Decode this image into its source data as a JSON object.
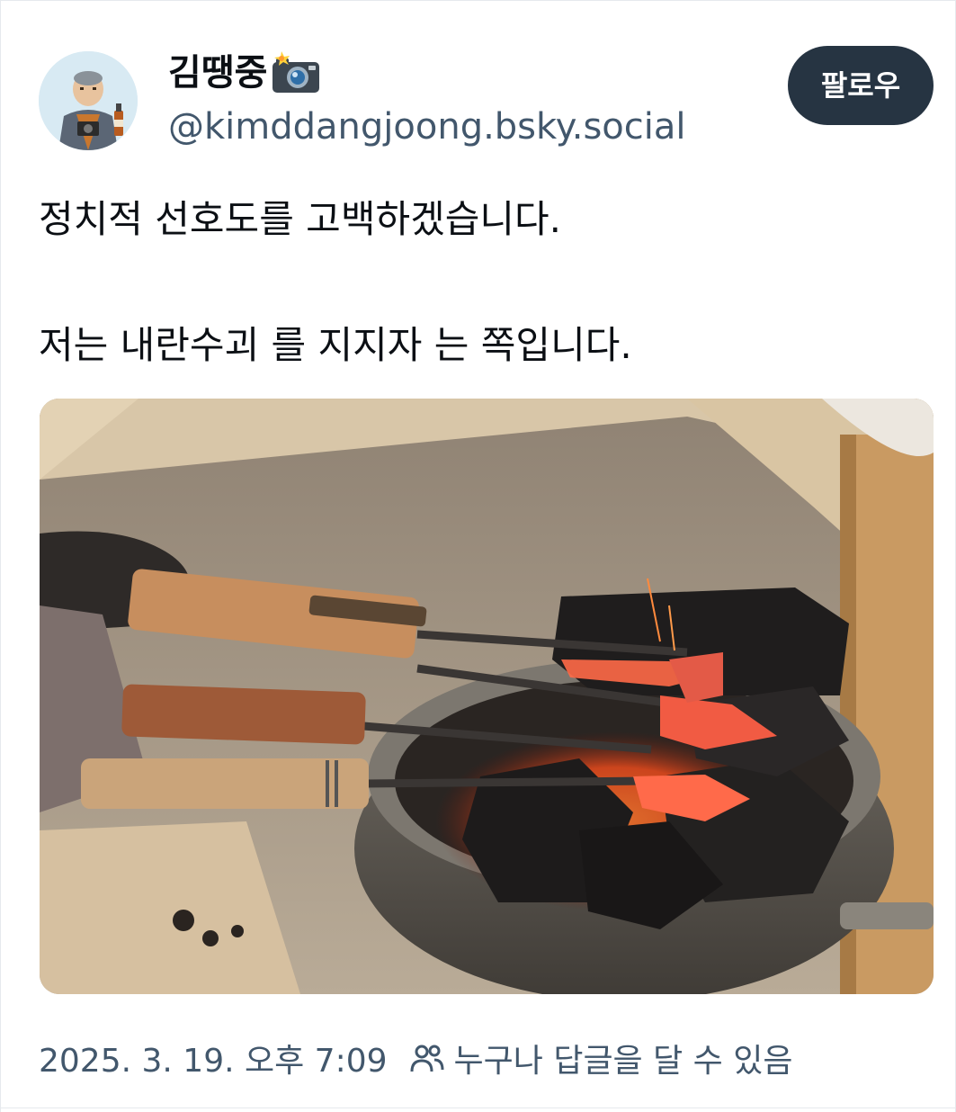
{
  "author": {
    "display_name": "김땡중",
    "name_emoji": "camera-with-flash-icon",
    "handle": "@kimddangjoong.bsky.social"
  },
  "follow_button": {
    "label": "팔로우"
  },
  "post": {
    "line1": "정치적 선호도를 고백하겠습니다.",
    "line2": "저는 내란수괴 를 지지자 는 쪽입니다."
  },
  "image": {
    "subject": "soldering-irons-heating-on-charcoal-brazier"
  },
  "meta": {
    "timestamp": "2025. 3. 19. 오후 7:09",
    "reply_icon": "people-icon",
    "reply_setting": "누구나 답글을 달 수 있음"
  },
  "colors": {
    "follow_bg": "#263442",
    "muted_text": "#42576c",
    "border": "#e6e9ed"
  }
}
